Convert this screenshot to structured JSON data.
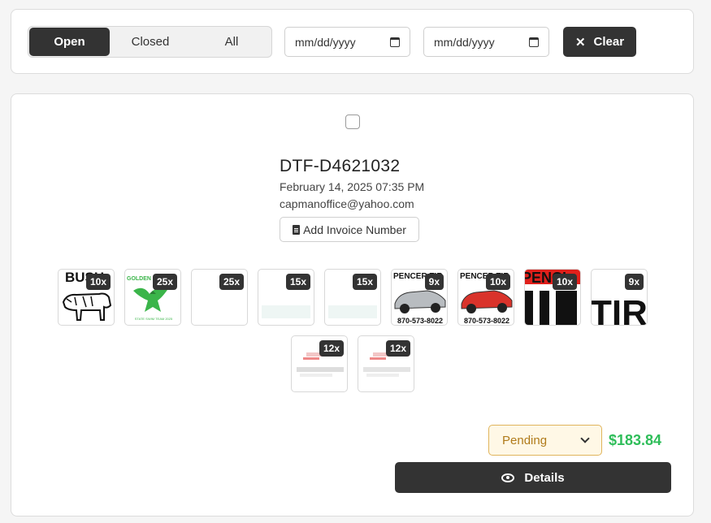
{
  "filters": {
    "tabs": [
      {
        "label": "Open",
        "active": true
      },
      {
        "label": "Closed",
        "active": false
      },
      {
        "label": "All",
        "active": false
      }
    ],
    "start_date_placeholder": "mm/dd/yyyy",
    "end_date_placeholder": "mm/dd/yyyy",
    "clear_label": "Clear"
  },
  "order": {
    "id": "DTF-D4621032",
    "date": "February 14, 2025 07:35 PM",
    "email": "capmanoffice@yahoo.com",
    "invoice_button_label": "Add Invoice Number",
    "items": [
      {
        "qty": "10x",
        "art": "bull",
        "art_text": "BUSH"
      },
      {
        "qty": "25x",
        "art": "eagle",
        "art_text": "GOLDEN",
        "art_caption": "STATE SWIM TEAM 2025"
      },
      {
        "qty": "25x",
        "art": "blank"
      },
      {
        "qty": "15x",
        "art": "faint"
      },
      {
        "qty": "15x",
        "art": "faint"
      },
      {
        "qty": "9x",
        "art": "car-silver",
        "art_text": "PENCER TIR",
        "art_phone": "870-573-8022"
      },
      {
        "qty": "10x",
        "art": "car-red",
        "art_text": "PENCER TIR",
        "art_phone": "870-573-8022"
      },
      {
        "qty": "10x",
        "art": "tire-red",
        "art_text": "PENCI"
      },
      {
        "qty": "9x",
        "art": "tire",
        "art_text": "TIR"
      },
      {
        "qty": "12x",
        "art": "blur-red"
      },
      {
        "qty": "12x",
        "art": "blur-red"
      }
    ],
    "status": "Pending",
    "total": "$183.84",
    "details_label": "Details"
  },
  "colors": {
    "accent_dark": "#333333",
    "status_bg": "#fff8e6",
    "status_border": "#e0b45c",
    "status_text": "#b07b1a",
    "price_green": "#2ebd59"
  },
  "icons": {
    "clear": "close-icon",
    "calendar": "calendar-icon",
    "invoice": "document-icon",
    "details": "eye-icon",
    "status": "chevron-down-icon"
  }
}
